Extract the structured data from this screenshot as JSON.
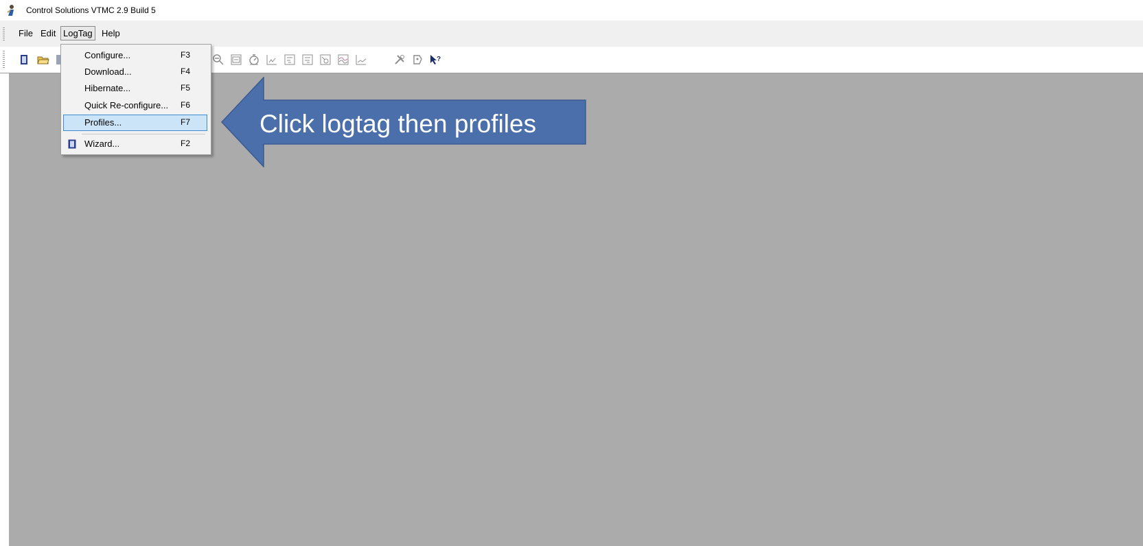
{
  "window": {
    "title": "Control Solutions VTMC 2.9 Build 5",
    "icon": "app-person-icon"
  },
  "menubar": {
    "items": [
      "File",
      "Edit",
      "LogTag",
      "Help"
    ],
    "open_menu": "LogTag"
  },
  "toolbar": {
    "buttons": [
      "new-document-icon",
      "open-folder-icon",
      "save-icon",
      "zoom-out-icon",
      "calendar-icon",
      "stopwatch-icon",
      "chart-icon-1",
      "chart-icon-2",
      "chart-icon-3",
      "summary-chart-icon",
      "multi-chart-icon",
      "line-chart-icon",
      "tools-icon",
      "tag-icon",
      "help-pointer-icon"
    ]
  },
  "logtag_menu": {
    "items": [
      {
        "label": "Configure...",
        "shortcut": "F3"
      },
      {
        "label": "Download...",
        "shortcut": "F4"
      },
      {
        "label": "Hibernate...",
        "shortcut": "F5"
      },
      {
        "label": "Quick Re-configure...",
        "shortcut": "F6"
      },
      {
        "label": "Profiles...",
        "shortcut": "F7",
        "selected": true
      },
      {
        "label": "Wizard...",
        "shortcut": "F2",
        "icon": "wizard-book-icon"
      }
    ]
  },
  "annotation": {
    "text": "Click logtag then profiles",
    "color": "#4a6faa"
  },
  "colors": {
    "client_area": "#ababab",
    "selection": "#cce4f7",
    "selection_border": "#3d8bd1"
  }
}
